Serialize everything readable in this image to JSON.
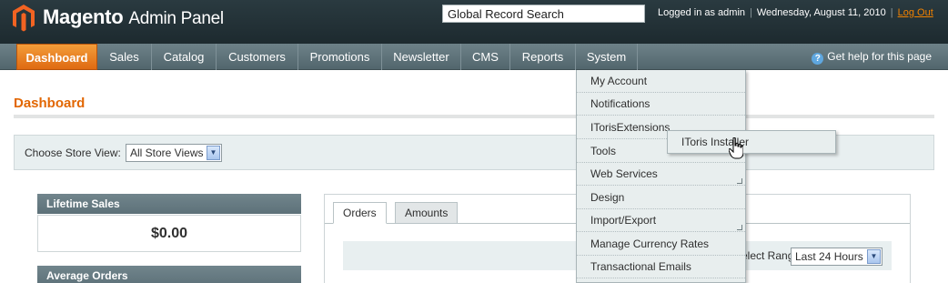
{
  "header": {
    "logo_text": "Magento",
    "logo_subtitle": "Admin Panel",
    "search_value": "Global Record Search",
    "logged_in": "Logged in as admin",
    "date": "Wednesday, August 11, 2010",
    "logout": "Log Out",
    "accent_color": "#f18200"
  },
  "nav": {
    "items": [
      "Dashboard",
      "Sales",
      "Catalog",
      "Customers",
      "Promotions",
      "Newsletter",
      "CMS",
      "Reports",
      "System"
    ],
    "active": "Dashboard",
    "open": "System",
    "help": "Get help for this page"
  },
  "system_menu": {
    "items": [
      "My Account",
      "Notifications",
      "ITorisExtensions",
      "Tools",
      "Web Services",
      "Design",
      "Import/Export",
      "Manage Currency Rates",
      "Transactional Emails"
    ],
    "submenu_item": "IToris Installer"
  },
  "page": {
    "title": "Dashboard",
    "store_view_label": "Choose Store View:",
    "store_view_value": "All Store Views"
  },
  "stats": {
    "lifetime_sales_label": "Lifetime Sales",
    "lifetime_sales_value": "$0.00",
    "average_orders_label": "Average Orders"
  },
  "tabs": {
    "items": [
      "Orders",
      "Amounts"
    ],
    "active": "Orders",
    "range_label": "Select Range:",
    "range_value": "Last 24 Hours"
  }
}
